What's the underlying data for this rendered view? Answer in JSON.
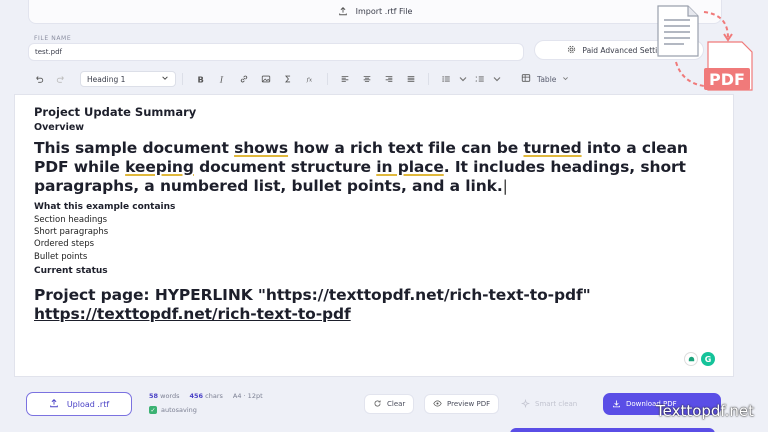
{
  "import": {
    "label": "Import .rtf File"
  },
  "file": {
    "label": "FILE NAME",
    "value": "test.pdf"
  },
  "advanced": {
    "label": "Paid Advanced Settings"
  },
  "toolbar": {
    "heading_value": "Heading 1",
    "table_label": "Table"
  },
  "document": {
    "title": "Project Update Summary",
    "overview": "Overview",
    "intro_parts": [
      "This sample document ",
      "shows",
      " how a rich text file can be ",
      "turned",
      " into a clean PDF while ",
      "keeping",
      " document structure ",
      "in place",
      ". It includes headings, short paragraphs, a numbered list, bullet points, and a link."
    ],
    "list_heading": "What this example contains",
    "items": [
      "Section headings",
      "Short paragraphs",
      "Ordered steps",
      "Bullet points"
    ],
    "status_heading": "Current status",
    "link_prefix": "Project page: HYPERLINK \"https://texttopdf.net/rich-text-to-pdf\" ",
    "link_text": "https://texttopdf.net/rich-text-to-pdf"
  },
  "footer": {
    "upload_label": "Upload .rtf",
    "words_count": "58",
    "words_label": "words",
    "chars_count": "456",
    "chars_label": "chars",
    "page_info": "A4 · 12pt",
    "autosave": "autosaving",
    "clear": "Clear",
    "preview": "Preview PDF",
    "smart": "Smart clean",
    "download": "Download PDF"
  },
  "logo": {
    "text": "PDF"
  },
  "watermark": "Texttopdf.net",
  "colors": {
    "accent": "#5a4ee6",
    "logo_red": "#f07a7a",
    "underline": "#e0b83c"
  }
}
